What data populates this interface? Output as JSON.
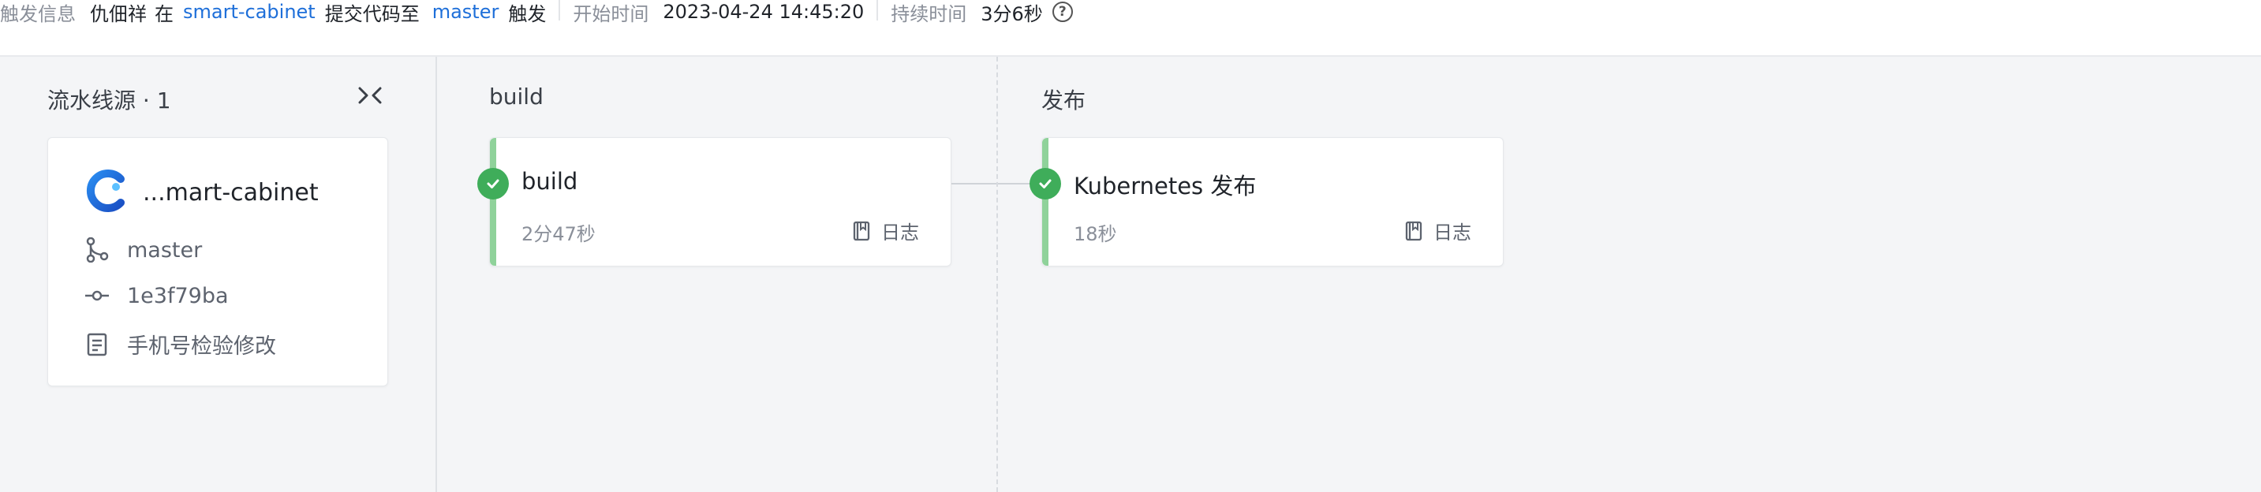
{
  "topbar": {
    "trigger_label": "触发信息",
    "trigger_user": "仇佃祥",
    "trigger_in": "在",
    "trigger_repo": "smart-cabinet",
    "trigger_action": "提交代码至",
    "trigger_branch": "master",
    "trigger_end": "触发",
    "start_label": "开始时间",
    "start_value": "2023-04-24 14:45:20",
    "duration_label": "持续时间",
    "duration_value": "3分6秒",
    "help_symbol": "?"
  },
  "source": {
    "title": "流水线源 · 1",
    "repo_name": "...mart-cabinet",
    "branch": "master",
    "commit": "1e3f79ba",
    "message": "手机号检验修改"
  },
  "stages": [
    {
      "title": "build",
      "job": {
        "name": "build",
        "duration": "2分47秒",
        "log_label": "日志",
        "status": "success"
      }
    },
    {
      "title": "发布",
      "job": {
        "name": "Kubernetes 发布",
        "duration": "18秒",
        "log_label": "日志",
        "status": "success"
      }
    }
  ],
  "colors": {
    "link": "#1e6fd9",
    "success": "#3fad5a",
    "accent_bar": "#8fd29a",
    "canvas_bg": "#f4f5f7"
  },
  "icons": [
    "help-icon",
    "collapse-icon",
    "repo-logo-icon",
    "branch-icon",
    "commit-icon",
    "message-icon",
    "check-icon",
    "log-book-icon"
  ]
}
